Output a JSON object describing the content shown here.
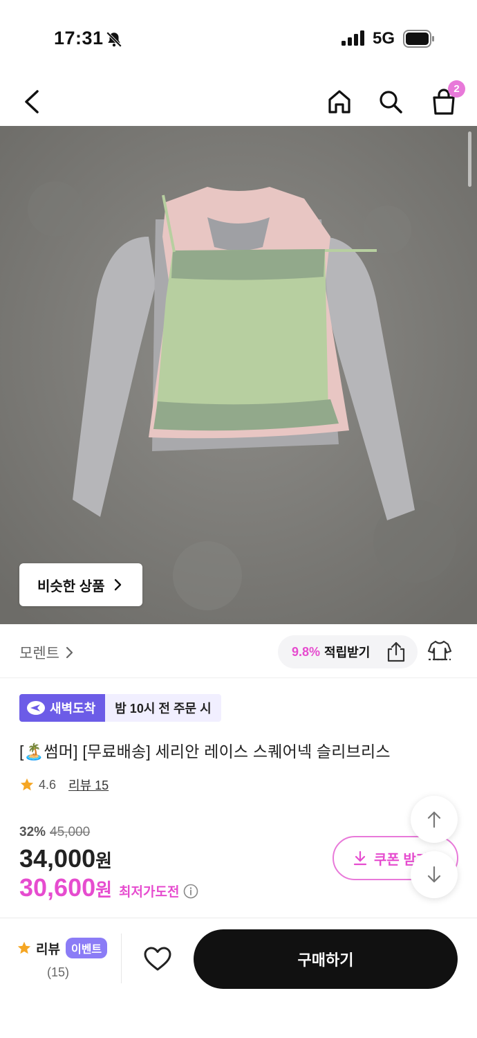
{
  "status_bar": {
    "time": "17:31",
    "network": "5G"
  },
  "header": {
    "cart_count": "2"
  },
  "image": {
    "similar_button_label": "비슷한 상품"
  },
  "brand": {
    "name": "모렌트",
    "points_percent": "9.8%",
    "points_label": "적립받기"
  },
  "delivery": {
    "tag_label": "새벽도착",
    "time_label": "밤 10시 전 주문 시"
  },
  "product": {
    "title": "[🏝️썸머] [무료배송] 세리안 레이스 스퀘어넥 슬리브리스",
    "rating": "4.6",
    "review_label": "리뷰 15"
  },
  "pricing": {
    "discount_percent": "32%",
    "original_price": "45,000",
    "price": "34,000",
    "price_unit": "원",
    "best_price": "30,600",
    "best_price_label": "최저가도전",
    "coupon_label": "쿠폰 받기"
  },
  "bottom_bar": {
    "review_label": "리뷰",
    "event_badge": "이벤트",
    "review_count": "(15)",
    "buy_label": "구매하기"
  },
  "colors": {
    "accent_pink": "#e64ccf",
    "delivery_purple": "#6c5ce7",
    "buy_black": "#111111"
  }
}
